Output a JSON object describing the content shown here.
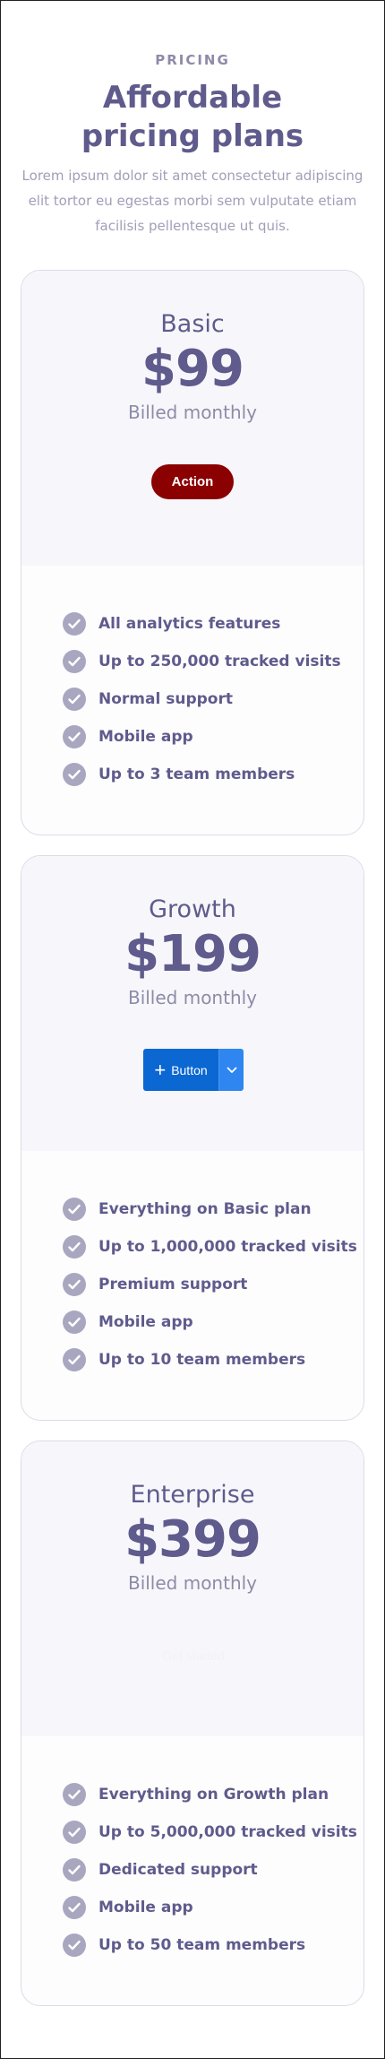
{
  "header": {
    "eyebrow": "PRICING",
    "title": "Affordable pricing plans",
    "description": "Lorem ipsum dolor sit amet consectetur adipiscing elit tortor eu egestas morbi sem vulputate etiam facilisis pellentesque ut quis."
  },
  "plans": [
    {
      "name": "Basic",
      "price": "$99",
      "billing": "Billed monthly",
      "button_label": "Action",
      "features": [
        "All analytics features",
        "Up to 250,000 tracked visits",
        "Normal support",
        "Mobile app",
        "Up to 3 team members"
      ]
    },
    {
      "name": "Growth",
      "price": "$199",
      "billing": "Billed monthly",
      "button_label": "Button",
      "features": [
        "Everything on Basic plan",
        "Up to 1,000,000 tracked visits",
        "Premium support",
        "Mobile app",
        "Up to 10 team members"
      ]
    },
    {
      "name": "Enterprise",
      "price": "$399",
      "billing": "Billed monthly",
      "button_label": "Get started",
      "features": [
        "Everything on Growth plan",
        "Up to 5,000,000 tracked visits",
        "Dedicated support",
        "Mobile app",
        "Up to 50 team members"
      ]
    }
  ],
  "icons": {
    "check": "check-circle-icon",
    "plus": "plus-icon",
    "dropdown": "chevron-down-icon"
  },
  "colors": {
    "text": "#5f5b8c",
    "muted": "#8e8ba8",
    "check": "#a9a6c0",
    "action_button": "#8b0000",
    "split_button": "#0b67d1",
    "split_toggle": "#2f86f0",
    "card_top": "#f7f7fb"
  }
}
